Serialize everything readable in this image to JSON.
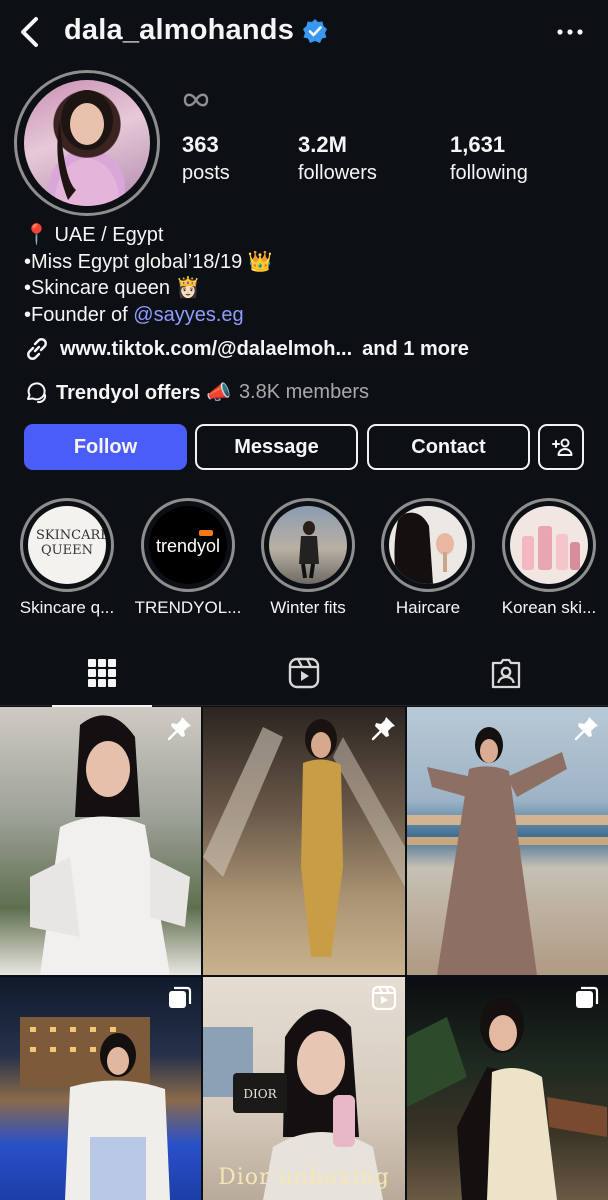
{
  "header": {
    "username": "dala_almohands",
    "back_icon": "chevron-left-icon",
    "verified_icon": "verified-badge-icon",
    "more_icon": "more-horizontal-icon"
  },
  "profile": {
    "threads_icon": "threads-infinity-icon",
    "stats": [
      {
        "value": "363",
        "label": "posts"
      },
      {
        "value": "3.2M",
        "label": "followers"
      },
      {
        "value": "1,631",
        "label": "following"
      }
    ],
    "bio_lines": [
      "📍 UAE  / Egypt",
      "•Miss Egypt global’18/19 👑",
      "•Skincare queen 👸🏻",
      "•Founder of "
    ],
    "bio_mention": "@sayyes.eg",
    "link_text": "www.tiktok.com/@dalaelmoh...",
    "link_more": "and 1 more",
    "channel_name": "Trendyol offers 📣",
    "channel_members": "3.8K members"
  },
  "buttons": {
    "follow": "Follow",
    "message": "Message",
    "contact": "Contact",
    "add_user_icon": "add-person-icon"
  },
  "highlights": [
    {
      "label": "Skincare q...",
      "inner_text": "SKINCARE QUEEN"
    },
    {
      "label": "TRENDYOL...",
      "inner_text": "trendyol"
    },
    {
      "label": "Winter fits"
    },
    {
      "label": "Haircare"
    },
    {
      "label": "Korean ski..."
    }
  ],
  "tabs": [
    "grid-icon",
    "reels-icon",
    "tagged-icon"
  ],
  "posts": [
    {
      "badge": "pin-icon"
    },
    {
      "badge": "pin-icon"
    },
    {
      "badge": "pin-icon"
    },
    {
      "badge": "carousel-icon"
    },
    {
      "badge": "reel-icon",
      "overlay_text": "Dior unboxing",
      "product_text": "DIOR"
    },
    {
      "badge": "carousel-icon"
    }
  ],
  "colors": {
    "background": "#0c1014",
    "follow_button": "#4a5df9",
    "verified": "#3897f0",
    "mention": "#8f9cff"
  }
}
